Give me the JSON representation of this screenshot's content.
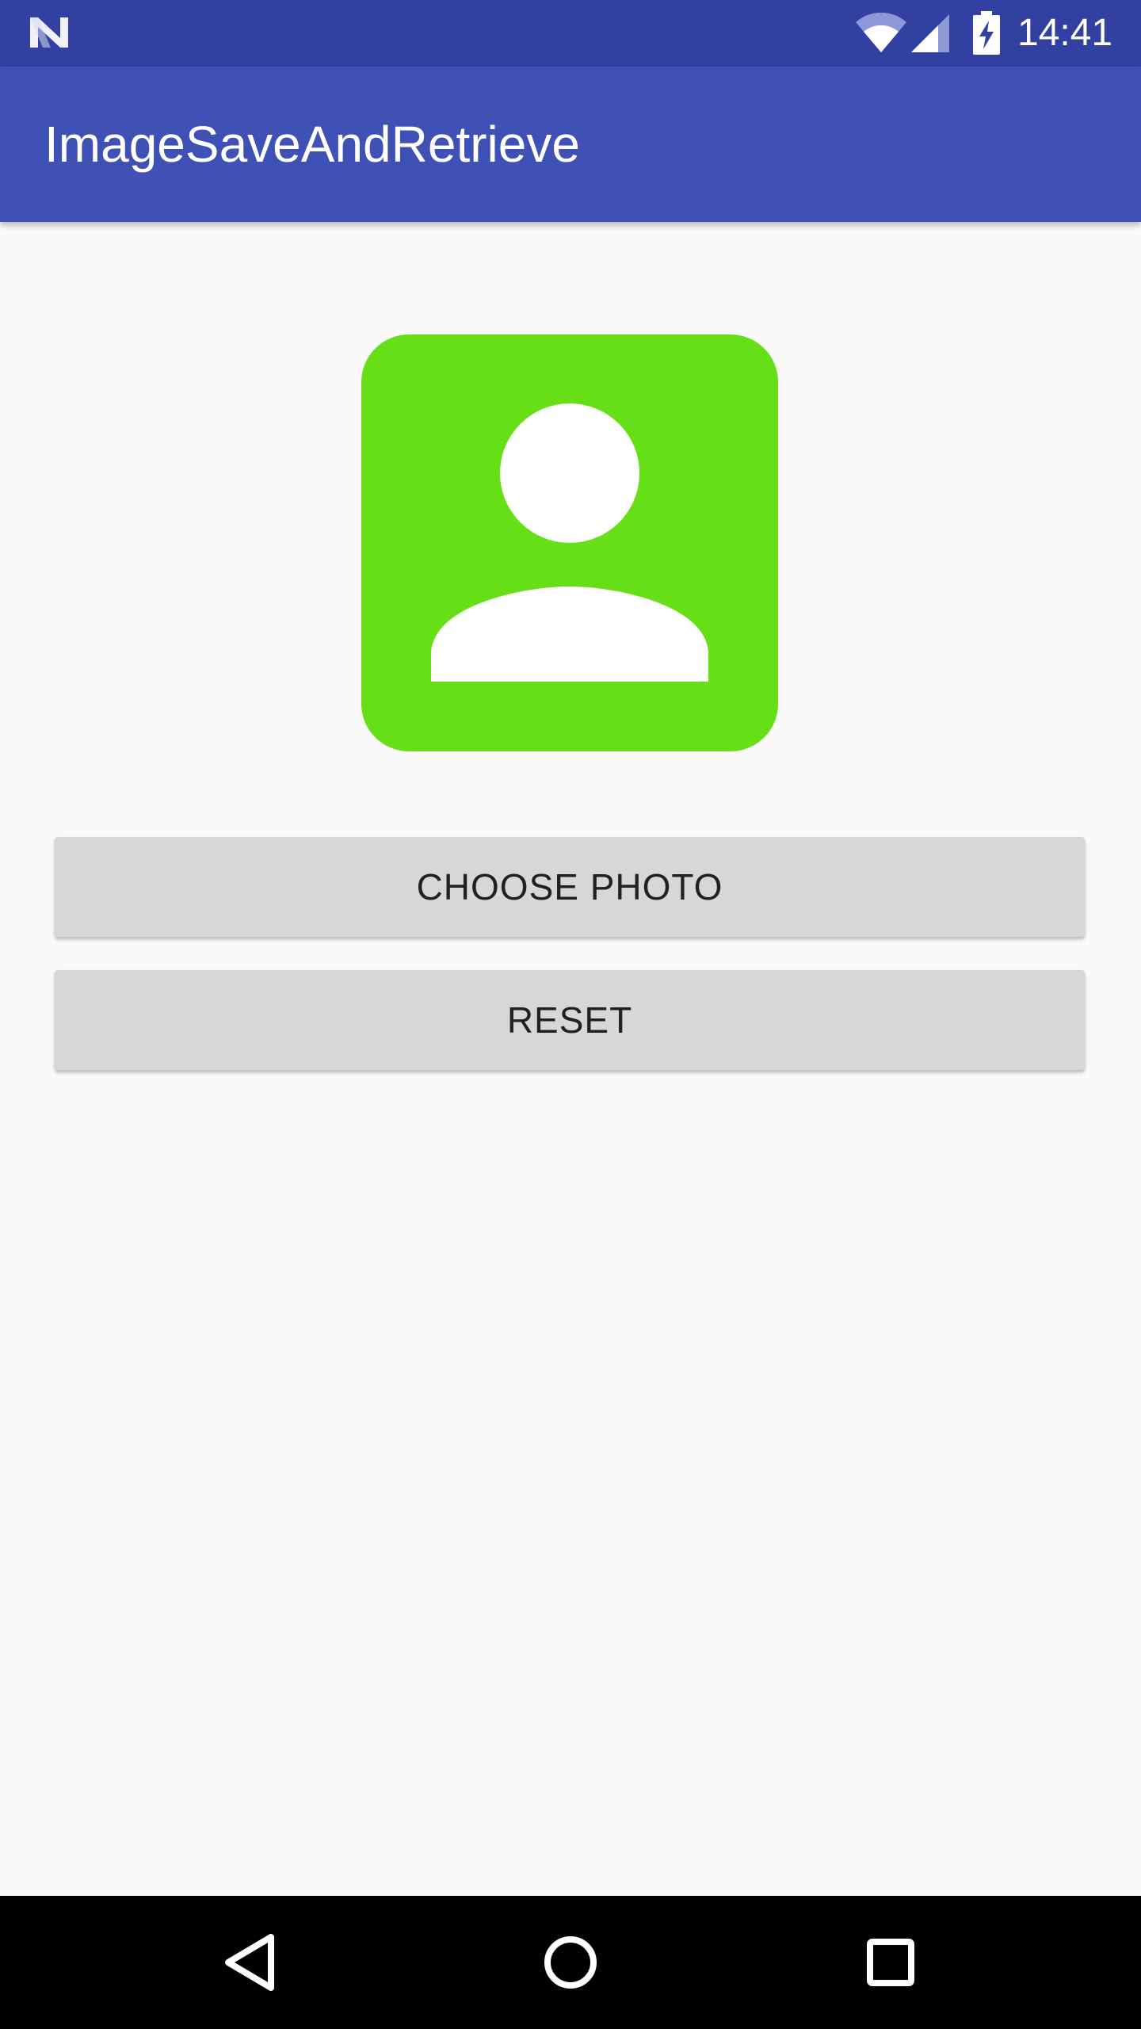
{
  "status_bar": {
    "time": "14:41",
    "icons": [
      "notification-n-icon",
      "wifi-icon",
      "cell-signal-icon",
      "battery-charging-icon"
    ],
    "background_color": "#3140a1"
  },
  "app_bar": {
    "title": "ImageSaveAndRetrieve",
    "background_color": "#3f51b5"
  },
  "main": {
    "photo": {
      "icon": "account-box-icon",
      "color": "#66df17"
    },
    "choose_photo_label": "CHOOSE PHOTO",
    "reset_label": "RESET",
    "button_color": "#d6d7d7"
  },
  "nav_bar": {
    "icons": [
      "back-icon",
      "home-icon",
      "recents-icon"
    ]
  }
}
